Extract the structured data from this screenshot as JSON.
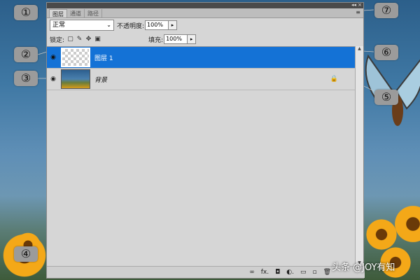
{
  "panel": {
    "tabs": [
      {
        "label": "图层"
      },
      {
        "label": "通道"
      },
      {
        "label": "路径"
      }
    ],
    "title_controls": {
      "collapse": "◂◂",
      "close": "×"
    },
    "menu_icon": "≡",
    "blend_mode": {
      "value": "正常"
    },
    "opacity": {
      "label": "不透明度:",
      "value": "100%"
    },
    "lock": {
      "label": "锁定:"
    },
    "fill": {
      "label": "填充:",
      "value": "100%"
    }
  },
  "layers": [
    {
      "name": "图层 1",
      "selected": true
    },
    {
      "name": "背景",
      "selected": false
    }
  ],
  "callouts": [
    "①",
    "②",
    "③",
    "④",
    "⑤",
    "⑥",
    "⑦"
  ],
  "icons": {
    "eye": "visibility-eye-icon",
    "lock": "lock-icon",
    "link": "link-layers-icon",
    "fx": "layer-style-icon",
    "mask": "add-mask-icon",
    "adjust": "adjustment-layer-icon",
    "folder": "group-icon",
    "new": "new-layer-icon",
    "trash": "delete-layer-icon"
  },
  "footer_icons": [
    "∞",
    "fx.",
    "◘",
    "◐.",
    "▭",
    "▫",
    "🗑"
  ],
  "watermark": "头条 @JOY有知"
}
